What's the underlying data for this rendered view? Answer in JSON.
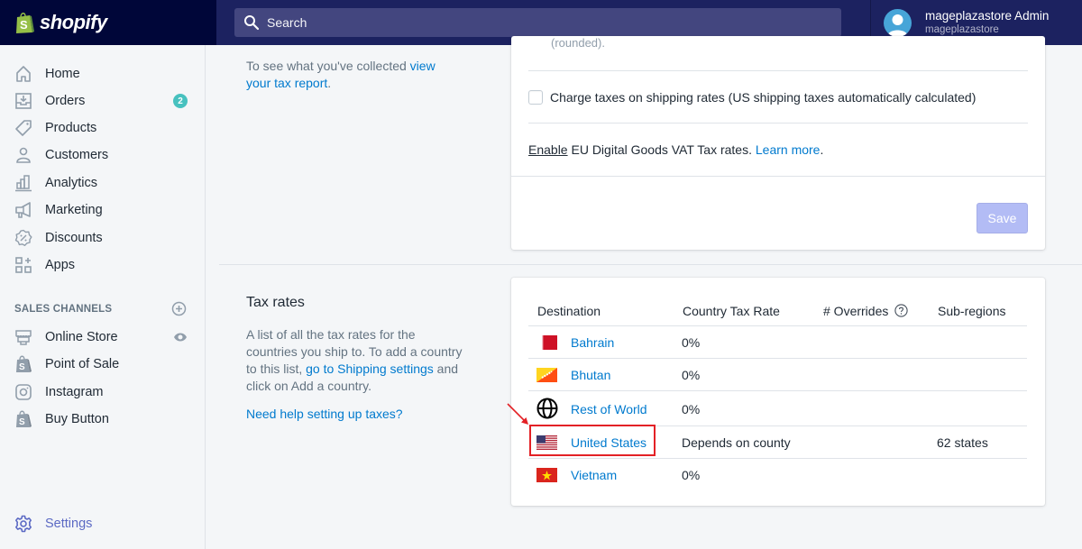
{
  "topbar": {
    "logo_text": "shopify",
    "search_placeholder": "Search",
    "user": {
      "name": "mageplazastore Admin",
      "store": "mageplazastore"
    }
  },
  "sidebar": {
    "items": [
      {
        "label": "Home",
        "icon": "home-icon"
      },
      {
        "label": "Orders",
        "icon": "orders-icon",
        "badge": "2"
      },
      {
        "label": "Products",
        "icon": "tag-icon"
      },
      {
        "label": "Customers",
        "icon": "person-icon"
      },
      {
        "label": "Analytics",
        "icon": "bar-chart-icon"
      },
      {
        "label": "Marketing",
        "icon": "megaphone-icon"
      },
      {
        "label": "Discounts",
        "icon": "discount-icon"
      },
      {
        "label": "Apps",
        "icon": "apps-icon"
      }
    ],
    "sales_channels": {
      "title": "SALES CHANNELS",
      "items": [
        {
          "label": "Online Store",
          "icon": "store-icon"
        },
        {
          "label": "Point of Sale",
          "icon": "shopify-bag-icon"
        },
        {
          "label": "Instagram",
          "icon": "instagram-icon"
        },
        {
          "label": "Buy Button",
          "icon": "shopify-bag-icon"
        }
      ]
    },
    "settings_label": "Settings"
  },
  "main": {
    "tax_report": {
      "text": "To see what you've collected ",
      "link": "view your tax report",
      "suffix": "."
    },
    "settings_card": {
      "rounded_text": "(rounded).",
      "shipping_checkbox_label": "Charge taxes on shipping rates (US shipping taxes automatically calculated)",
      "shipping_checked": false,
      "eu_enable": "Enable",
      "eu_text": " EU Digital Goods VAT Tax rates. ",
      "eu_learn_more": "Learn more",
      "eu_suffix": ".",
      "save_label": "Save"
    },
    "tax_rates": {
      "title": "Tax rates",
      "description_1": "A list of all the tax rates for the countries you ship to. To add a country to this list, ",
      "shipping_link": "go to Shipping settings",
      "description_2": " and click on Add a country.",
      "help_link": "Need help setting up taxes?",
      "columns": [
        "Destination",
        "Country Tax Rate",
        "# Overrides",
        "Sub-regions"
      ],
      "rows": [
        {
          "destination": "Bahrain",
          "flag": "bahrain-flag",
          "rate": "0%",
          "overrides": "",
          "subregions": ""
        },
        {
          "destination": "Bhutan",
          "flag": "bhutan-flag",
          "rate": "0%",
          "overrides": "",
          "subregions": ""
        },
        {
          "destination": "Rest of World",
          "flag": "globe-icon",
          "rate": "0%",
          "overrides": "",
          "subregions": ""
        },
        {
          "destination": "United States",
          "flag": "us-flag",
          "rate": "Depends on county",
          "overrides": "",
          "subregions": "62 states",
          "highlighted": true
        },
        {
          "destination": "Vietnam",
          "flag": "vietnam-flag",
          "rate": "0%",
          "overrides": "",
          "subregions": ""
        }
      ]
    }
  },
  "colors": {
    "topbar": "#1c2260",
    "logo_bg": "#000639",
    "search_bg": "#43467f",
    "link": "#007ace",
    "badge": "#47c1bf",
    "save_disabled": "#b3bcf5",
    "highlight": "#e32126",
    "settings": "#5c6ac4"
  }
}
